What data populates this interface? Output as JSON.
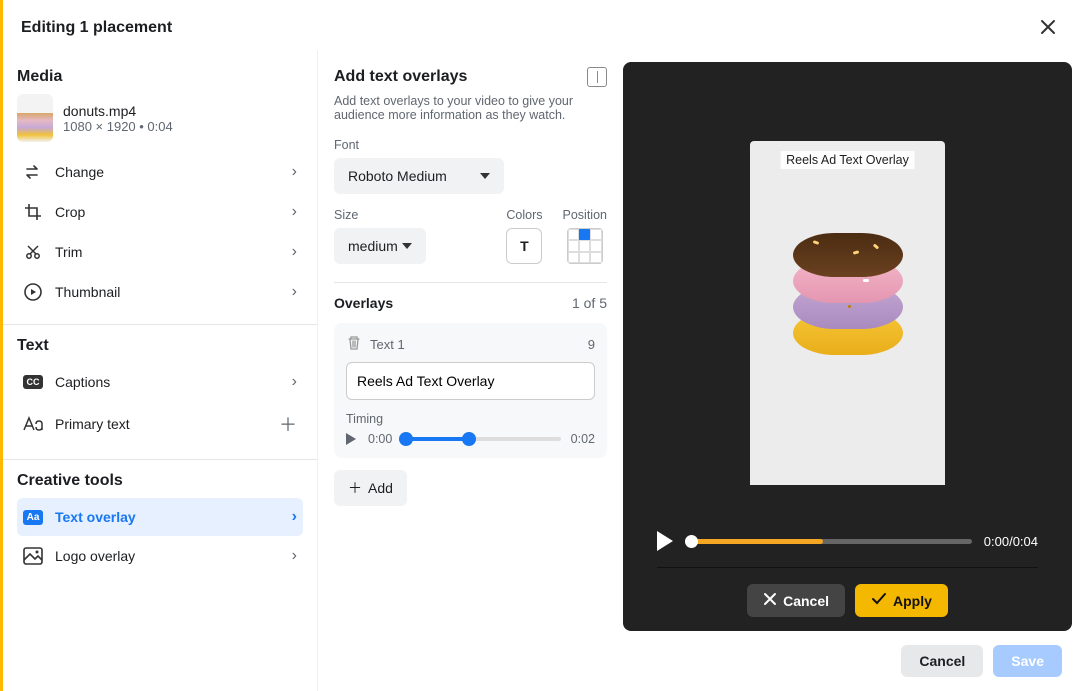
{
  "header": {
    "title": "Editing 1 placement"
  },
  "media": {
    "heading": "Media",
    "filename": "donuts.mp4",
    "meta": "1080 × 1920 • 0:04",
    "items": {
      "change": "Change",
      "crop": "Crop",
      "trim": "Trim",
      "thumbnail": "Thumbnail"
    }
  },
  "textSection": {
    "heading": "Text",
    "captions": "Captions",
    "primary": "Primary text"
  },
  "tools": {
    "heading": "Creative tools",
    "textOverlay": "Text overlay",
    "logoOverlay": "Logo overlay"
  },
  "overlayPanel": {
    "title": "Add text overlays",
    "desc": "Add text overlays to your video to give your audience more information as they watch.",
    "fontLabel": "Font",
    "fontValue": "Roboto Medium",
    "sizeLabel": "Size",
    "sizeValue": "medium",
    "colorsLabel": "Colors",
    "colorSample": "T",
    "positionLabel": "Position",
    "overlaysLabel": "Overlays",
    "overlaysCount": "1 of 5",
    "item": {
      "name": "Text 1",
      "points": "9",
      "value": "Reels Ad Text Overlay",
      "timingLabel": "Timing",
      "start": "0:00",
      "end": "0:02"
    },
    "addLabel": "Add"
  },
  "preview": {
    "overlayText": "Reels Ad Text Overlay",
    "time": "0:00/0:04",
    "cancel": "Cancel",
    "apply": "Apply"
  },
  "footer": {
    "cancel": "Cancel",
    "save": "Save"
  }
}
